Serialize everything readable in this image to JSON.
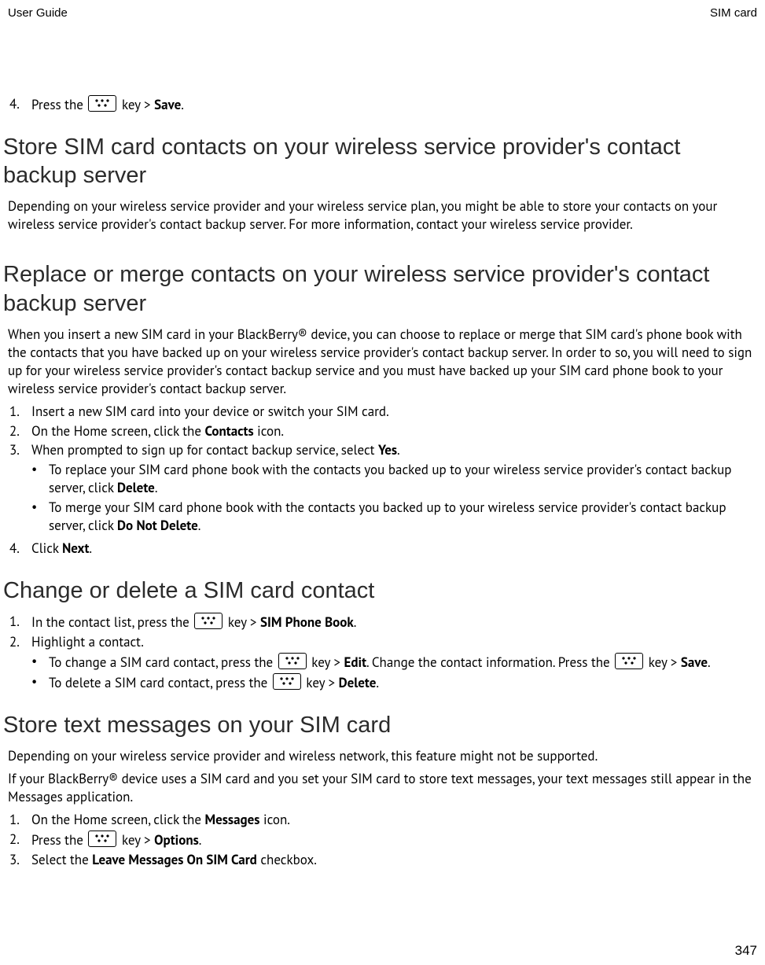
{
  "header": {
    "left": "User Guide",
    "right": "SIM card"
  },
  "page_number": "347",
  "top_step": {
    "num": "4.",
    "pre": "Press the ",
    "post_key": " key > ",
    "bold": "Save",
    "suffix": "."
  },
  "sections": [
    {
      "title": "Store SIM card contacts on your wireless service provider's contact backup server",
      "paragraphs": [
        "Depending on your wireless service provider and your wireless service plan, you might be able to store your contacts on your wireless service provider's contact backup server. For more information, contact your wireless service provider."
      ]
    }
  ],
  "section_replace": {
    "title": "Replace or merge contacts on your wireless service provider's contact backup server",
    "intro": "When you insert a new SIM card in your BlackBerry® device, you can choose to replace or merge that SIM card's phone book with the contacts that you have backed up on your wireless service provider's contact backup server. In order to so, you will need to sign up for your wireless service provider's contact backup service and you must have backed up your SIM card phone book to your wireless service provider's contact backup server.",
    "steps": [
      {
        "num": "1.",
        "text": "Insert a new SIM card into your device or switch your SIM card."
      },
      {
        "num": "2.",
        "pre": "On the Home screen, click the ",
        "bold": "Contacts",
        "post": " icon."
      },
      {
        "num": "3.",
        "pre": "When prompted to sign up for contact backup service, select ",
        "bold": "Yes",
        "post": "."
      }
    ],
    "sub_bullets": [
      {
        "pre": "To replace your SIM card phone book with the contacts you backed up to your wireless service provider's contact backup server, click ",
        "bold": "Delete",
        "post": "."
      },
      {
        "pre": "To merge your SIM card phone book with the contacts you backed up to your wireless service provider's contact backup server, click ",
        "bold": "Do Not Delete",
        "post": "."
      }
    ],
    "step4": {
      "num": "4.",
      "pre": "Click ",
      "bold": "Next",
      "post": "."
    }
  },
  "section_change": {
    "title": "Change or delete a SIM card contact",
    "step1": {
      "num": "1.",
      "pre": "In the contact list, press the ",
      "post_key": " key > ",
      "bold": "SIM Phone Book",
      "suffix": "."
    },
    "step2": {
      "num": "2.",
      "text": "Highlight a contact."
    },
    "bullets": [
      {
        "pre": "To change a SIM card contact, press the ",
        "post_key1": " key > ",
        "bold1": "Edit",
        "mid": ". Change the contact information. Press the ",
        "post_key2": " key > ",
        "bold2": "Save",
        "suffix": "."
      },
      {
        "pre": "To delete a SIM card contact, press the ",
        "post_key1": " key > ",
        "bold1": "Delete",
        "suffix": "."
      }
    ]
  },
  "section_store": {
    "title": "Store text messages on your SIM card",
    "para1": "Depending on your wireless service provider and wireless network, this feature might not be supported.",
    "para2": "If your BlackBerry® device uses a SIM card and you set your SIM card to store text messages, your text messages still appear in the Messages application.",
    "steps": [
      {
        "num": "1.",
        "pre": "On the Home screen, click the ",
        "bold": "Messages",
        "post": " icon."
      },
      {
        "num": "2.",
        "pre": "Press the ",
        "key": true,
        "post_key": " key > ",
        "bold": "Options",
        "suffix": "."
      },
      {
        "num": "3.",
        "pre": "Select the ",
        "bold": "Leave Messages On SIM Card",
        "post": " checkbox."
      }
    ]
  }
}
